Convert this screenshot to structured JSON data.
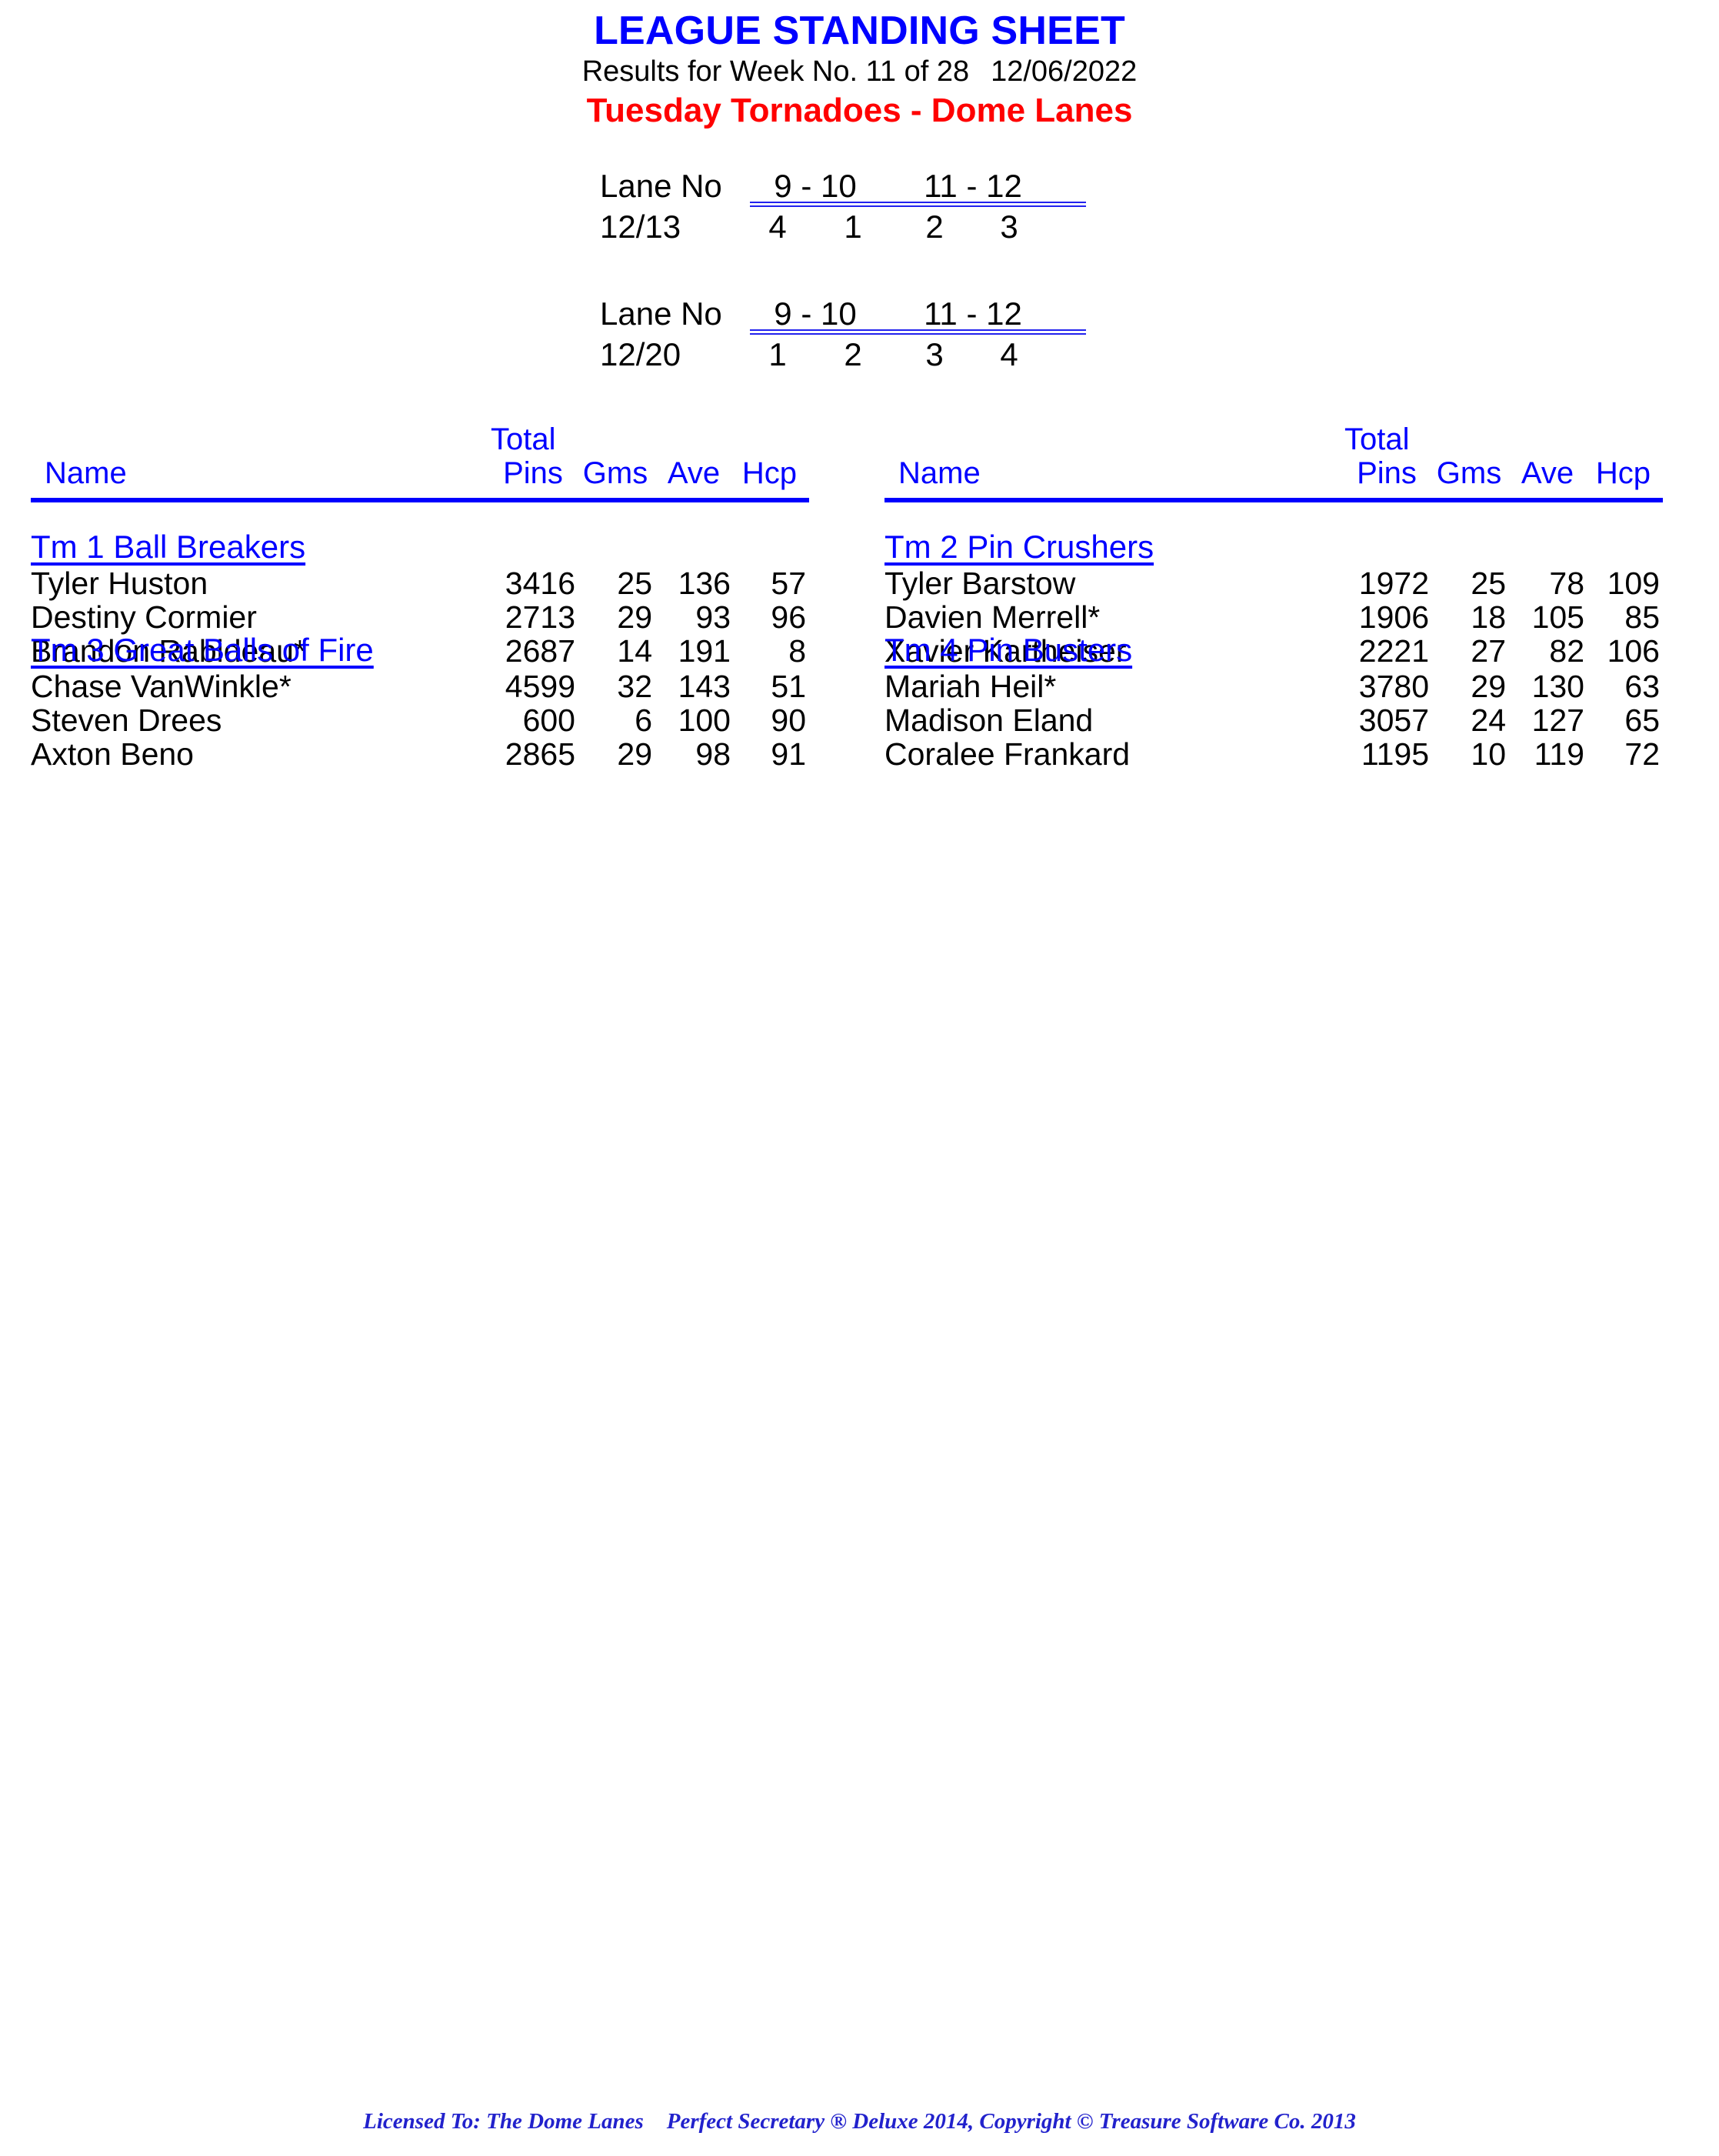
{
  "header": {
    "title": "LEAGUE STANDING SHEET",
    "results_prefix": "Results for Week No. 11 of 28",
    "date": "12/06/2022",
    "league": "Tuesday Tornadoes - Dome Lanes"
  },
  "lane_schedule": [
    {
      "lane_no_label": "Lane No",
      "lane_pair_1": "9 - 10",
      "lane_pair_2": "11 - 12",
      "date": "12/13",
      "teams": [
        "4",
        "1",
        "2",
        "3"
      ]
    },
    {
      "lane_no_label": "Lane No",
      "lane_pair_1": "9 - 10",
      "lane_pair_2": "11 - 12",
      "date": "12/20",
      "teams": [
        "1",
        "2",
        "3",
        "4"
      ]
    }
  ],
  "columns": {
    "name": "Name",
    "total": "Total",
    "pins": "Pins",
    "gms": "Gms",
    "ave": "Ave",
    "hcp": "Hcp"
  },
  "teams": [
    {
      "name": "Tm 1 Ball Breakers",
      "players": [
        {
          "name": "Tyler Huston",
          "pins": "3416",
          "gms": "25",
          "ave": "136",
          "hcp": "57"
        },
        {
          "name": "Destiny Cormier",
          "pins": "2713",
          "gms": "29",
          "ave": "93",
          "hcp": "96"
        },
        {
          "name": "Brandon Rabideau*",
          "pins": "2687",
          "gms": "14",
          "ave": "191",
          "hcp": "8"
        }
      ]
    },
    {
      "name": "Tm 2 Pin Crushers",
      "players": [
        {
          "name": "Tyler Barstow",
          "pins": "1972",
          "gms": "25",
          "ave": "78",
          "hcp": "109"
        },
        {
          "name": "Davien Merrell*",
          "pins": "1906",
          "gms": "18",
          "ave": "105",
          "hcp": "85"
        },
        {
          "name": "Xavier Kartheiser",
          "pins": "2221",
          "gms": "27",
          "ave": "82",
          "hcp": "106"
        }
      ]
    },
    {
      "name": "Tm 3 Great Balls of Fire",
      "players": [
        {
          "name": "Chase VanWinkle*",
          "pins": "4599",
          "gms": "32",
          "ave": "143",
          "hcp": "51"
        },
        {
          "name": "Steven Drees",
          "pins": "600",
          "gms": "6",
          "ave": "100",
          "hcp": "90"
        },
        {
          "name": "Axton Beno",
          "pins": "2865",
          "gms": "29",
          "ave": "98",
          "hcp": "91"
        }
      ]
    },
    {
      "name": "Tm 4 Pin Busters",
      "players": [
        {
          "name": "Mariah Heil*",
          "pins": "3780",
          "gms": "29",
          "ave": "130",
          "hcp": "63"
        },
        {
          "name": "Madison Eland",
          "pins": "3057",
          "gms": "24",
          "ave": "127",
          "hcp": "65"
        },
        {
          "name": "Coralee Frankard",
          "pins": "1195",
          "gms": "10",
          "ave": "119",
          "hcp": "72"
        }
      ]
    }
  ],
  "footer": {
    "licensed_to": "Licensed To: The Dome Lanes",
    "software": "Perfect Secretary ® Deluxe  2014, Copyright © Treasure Software Co. 2013"
  },
  "colors": {
    "title_blue": "#0000ff",
    "league_red": "#ff0000",
    "rule_blue": "#2222ee",
    "footer_blue": "#2222cc"
  }
}
